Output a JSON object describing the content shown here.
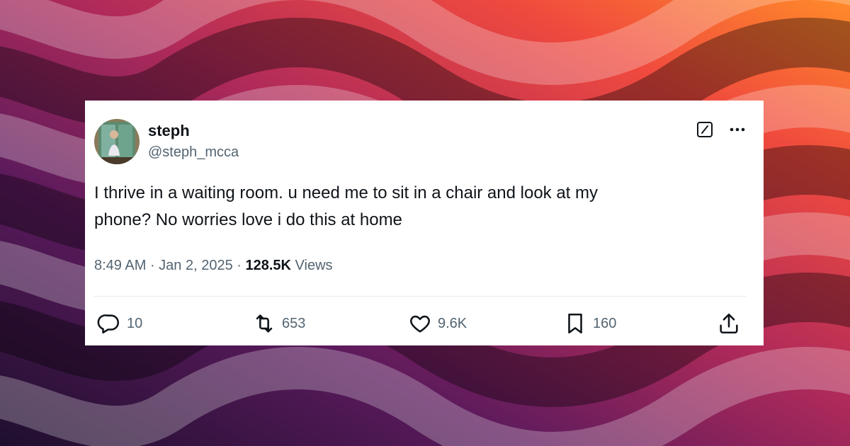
{
  "colors": {
    "text_primary": "#0f1419",
    "text_secondary": "#536471",
    "card_bg": "#ffffff"
  },
  "tweet": {
    "display_name": "steph",
    "handle": "@steph_mcca",
    "text_line1": "I thrive in a waiting room. u need me to sit in a chair and look at my",
    "text_line2": "phone?  No worries love i do this at home",
    "time": "8:49 AM",
    "separator1": " · ",
    "date": "Jan 2, 2025",
    "separator2": " · ",
    "views_count": "128.5K",
    "views_label": " Views",
    "actions": {
      "replies": "10",
      "reposts": "653",
      "likes": "9.6K",
      "bookmarks": "160"
    }
  },
  "icons": [
    "grok-icon",
    "more-icon",
    "reply-icon",
    "repost-icon",
    "like-icon",
    "bookmark-icon",
    "share-icon"
  ]
}
